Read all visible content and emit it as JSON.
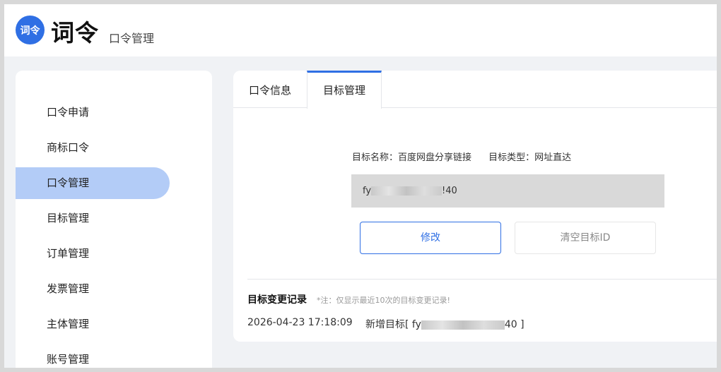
{
  "header": {
    "logo_badge": "词令",
    "logo_text": "词令",
    "subtitle": "口令管理"
  },
  "sidebar": {
    "items": [
      {
        "label": "口令申请"
      },
      {
        "label": "商标口令"
      },
      {
        "label": "口令管理",
        "active": true
      },
      {
        "label": "目标管理"
      },
      {
        "label": "订单管理"
      },
      {
        "label": "发票管理"
      },
      {
        "label": "主体管理"
      },
      {
        "label": "账号管理"
      }
    ]
  },
  "tabs": [
    {
      "label": "口令信息"
    },
    {
      "label": "目标管理",
      "active": true
    }
  ],
  "target": {
    "name_label": "目标名称：百度网盘分享链接",
    "type_label": "目标类型：网址直达",
    "value_prefix": "fy",
    "value_suffix": "!40",
    "edit_label": "修改",
    "clear_label": "清空目标ID"
  },
  "log": {
    "title": "目标变更记录",
    "note": "*注：仅显示最近10次的目标变更记录!",
    "entries": [
      {
        "time": "2026-04-23 17:18:09",
        "action_prefix": "新增目标[ fy",
        "action_suffix": "40 ]"
      }
    ]
  },
  "colors": {
    "accent": "#2f6fe4",
    "active_nav_bg": "#b3ccf7",
    "page_bg": "#f0f2f5"
  }
}
